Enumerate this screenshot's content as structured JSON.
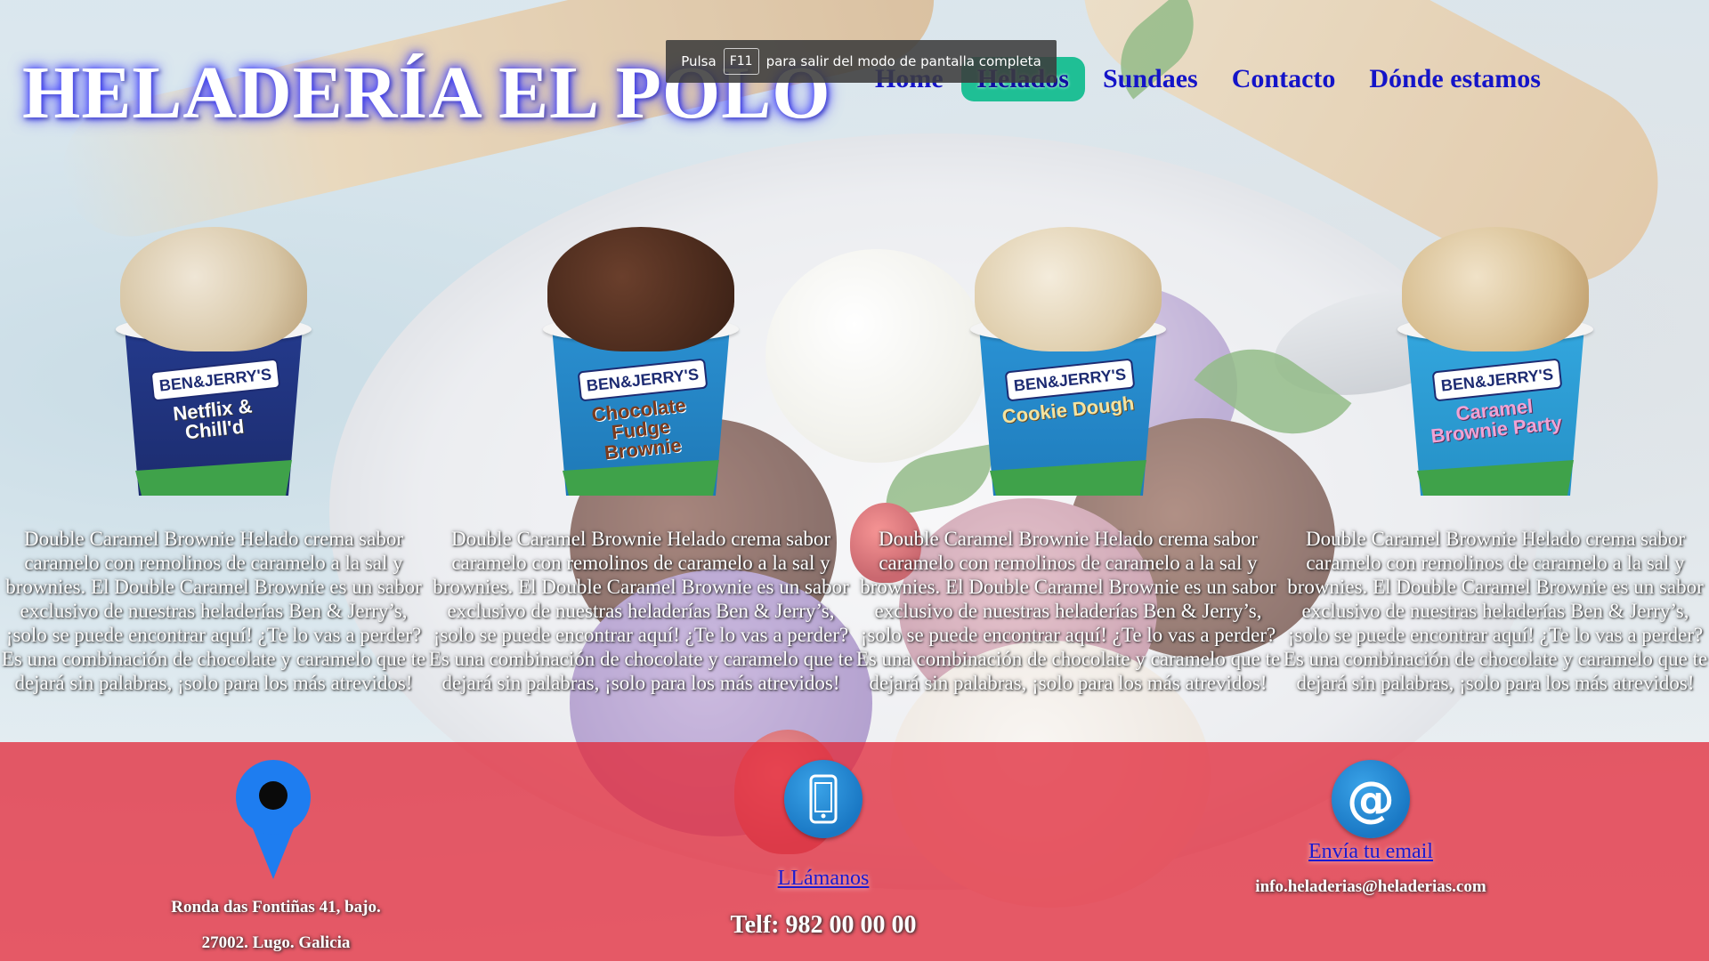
{
  "header": {
    "brand": "HELADERÍA EL POLO",
    "nav": [
      {
        "label": "Home",
        "active": false
      },
      {
        "label": "Helados",
        "active": true
      },
      {
        "label": "Sundaes",
        "active": false
      },
      {
        "label": "Contacto",
        "active": false
      },
      {
        "label": "Dónde estamos",
        "active": false
      }
    ]
  },
  "toast": {
    "before": "Pulsa",
    "key": "F11",
    "after": "para salir del modo de pantalla completa"
  },
  "products": [
    {
      "logo": "BEN&JERRY'S",
      "flavor": "Netflix & Chill'd",
      "description": "Double Caramel Brownie Helado crema sabor caramelo con remolinos de caramelo a la sal y brownies. El Double Caramel Brownie es un sabor exclusivo de nuestras heladerías Ben & Jerry’s, ¡solo se puede encontrar aquí! ¿Te lo vas a perder? Es una combinación de chocolate y caramelo que te dejará sin palabras, ¡solo para los más atrevidos!"
    },
    {
      "logo": "BEN&JERRY'S",
      "flavor": "Chocolate Fudge Brownie",
      "description": "Double Caramel Brownie Helado crema sabor caramelo con remolinos de caramelo a la sal y brownies. El Double Caramel Brownie es un sabor exclusivo de nuestras heladerías Ben & Jerry’s, ¡solo se puede encontrar aquí! ¿Te lo vas a perder? Es una combinación de chocolate y caramelo que te dejará sin palabras, ¡solo para los más atrevidos!"
    },
    {
      "logo": "BEN&JERRY'S",
      "flavor": "Cookie Dough",
      "description": "Double Caramel Brownie Helado crema sabor caramelo con remolinos de caramelo a la sal y brownies. El Double Caramel Brownie es un sabor exclusivo de nuestras heladerías Ben & Jerry’s, ¡solo se puede encontrar aquí! ¿Te lo vas a perder? Es una combinación de chocolate y caramelo que te dejará sin palabras, ¡solo para los más atrevidos!"
    },
    {
      "logo": "BEN&JERRY'S",
      "flavor": "Caramel Brownie Party",
      "description": "Double Caramel Brownie Helado crema sabor caramelo con remolinos de caramelo a la sal y brownies. El Double Caramel Brownie es un sabor exclusivo de nuestras heladerías Ben & Jerry’s, ¡solo se puede encontrar aquí! ¿Te lo vas a perder? Es una combinación de chocolate y caramelo que te dejará sin palabras, ¡solo para los más atrevidos!"
    }
  ],
  "footer": {
    "location": {
      "icon": "map-pin-icon",
      "address_line1": "Ronda das Fontiñas 41, bajo.",
      "address_line2": "27002. Lugo. Galicia"
    },
    "phone": {
      "icon": "smartphone-icon",
      "link": "LLámanos",
      "number": "Telf: 982 00 00 00"
    },
    "email": {
      "icon": "at-sign-icon",
      "glyph": "@",
      "link": "Envía tu email",
      "address": "info.heladerias@heladerias.com"
    }
  },
  "colors": {
    "nav_text": "#1414c8",
    "nav_active_bg": "#1fbf95",
    "footer_bg": "#e12d3e",
    "icon_blue": "#1e7df0"
  }
}
